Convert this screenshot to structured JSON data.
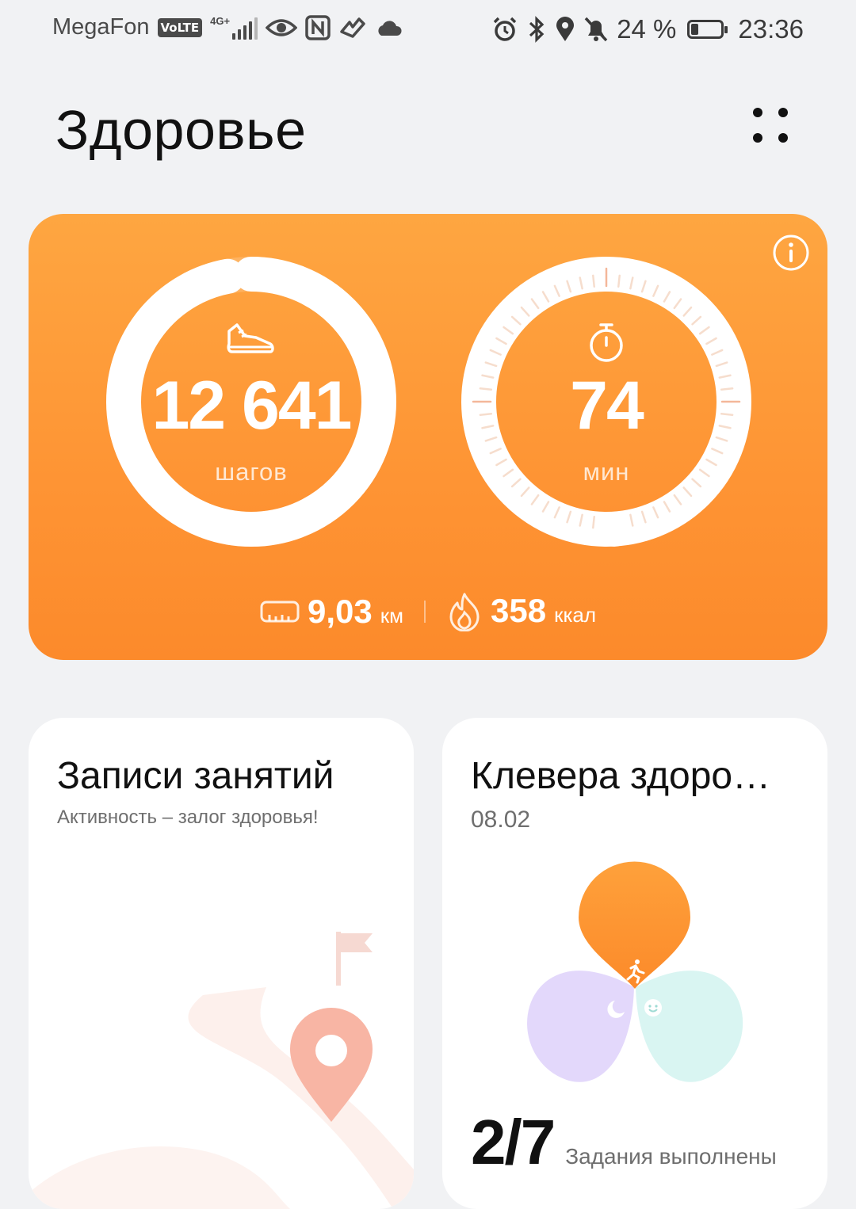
{
  "status_bar": {
    "carrier": "MegaFon",
    "volte": "VoLTE",
    "network": "4G+",
    "battery_percent": "24 %",
    "battery_level": 0.24,
    "time": "23:36"
  },
  "header": {
    "title": "Здоровье"
  },
  "activity": {
    "steps_value": "12 641",
    "steps_unit": "шагов",
    "steps_progress": 0.97,
    "minutes_value": "74",
    "minutes_unit": "мин",
    "minutes_progress": 0.5,
    "distance_value": "9,03",
    "distance_unit": "км",
    "calories_value": "358",
    "calories_unit": "ккал",
    "accent_color": "#fe9434"
  },
  "workouts_card": {
    "title": "Записи занятий",
    "subtitle": "Активность – залог здоровья!"
  },
  "clover_card": {
    "title": "Клевера здоро…",
    "date": "08.02",
    "tasks_count": "2/7",
    "tasks_label": "Задания выполнены",
    "petal_colors": {
      "activity": "#fd9030",
      "sleep": "#e1d6fb",
      "mood": "#d6f4f0"
    }
  }
}
